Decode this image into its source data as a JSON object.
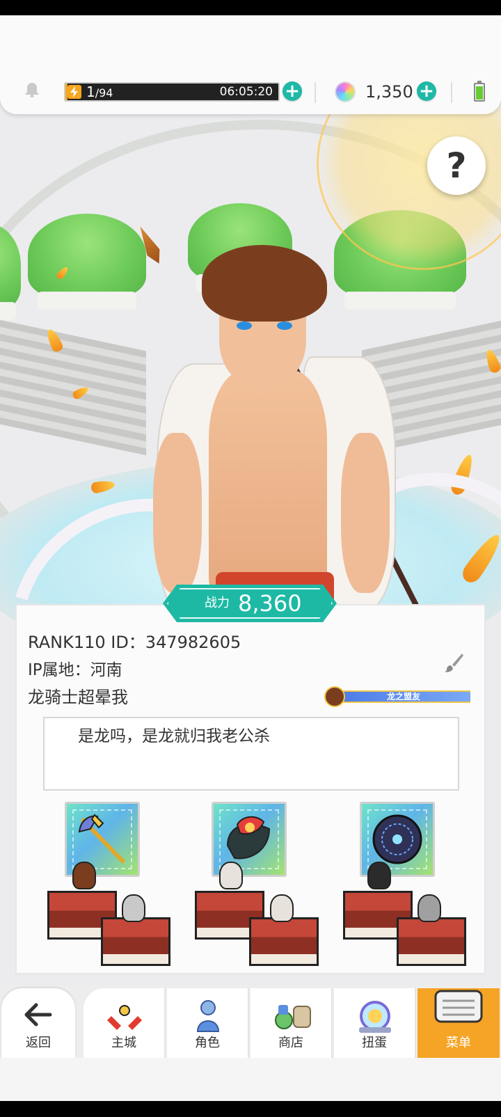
{
  "status_bar": {
    "stamina_value": "1",
    "stamina_max": "/94",
    "stamina_fraction": 0.0106,
    "timer": "06:05:20",
    "gem_count": "1,350"
  },
  "profile": {
    "power_label": "战力",
    "power_value": "8,360",
    "rank_id": "RANK110  ID：347982605",
    "ip_location": "IP属地：河南",
    "player_name": "龙骑士超晕我",
    "title_badge": "龙之盟友",
    "bio": "是龙吗，是龙就归我老公杀"
  },
  "equipment": [
    {
      "name": "axe-staff-icon"
    },
    {
      "name": "flame-shield-icon"
    },
    {
      "name": "dark-orb-icon"
    }
  ],
  "nav": {
    "back_label": "返回",
    "items": [
      {
        "label": "主城"
      },
      {
        "label": "角色"
      },
      {
        "label": "商店"
      },
      {
        "label": "扭蛋"
      },
      {
        "label": "菜单"
      }
    ]
  },
  "colors": {
    "accent_teal": "#1db9a5",
    "menu_orange": "#f6a425"
  }
}
